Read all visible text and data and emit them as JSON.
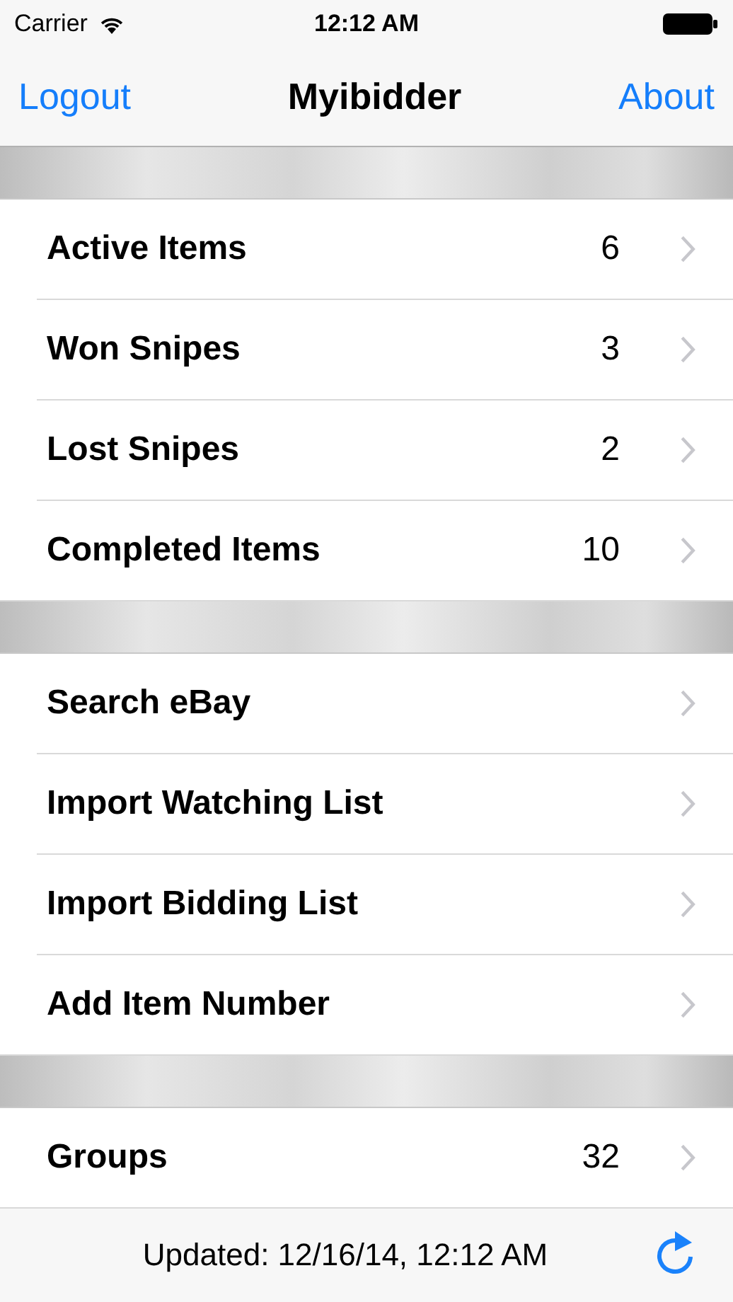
{
  "status_bar": {
    "carrier": "Carrier",
    "time": "12:12 AM"
  },
  "nav_bar": {
    "left_button": "Logout",
    "title": "Myibidder",
    "right_button": "About"
  },
  "sections": [
    {
      "rows": [
        {
          "label": "Active Items",
          "count": "6"
        },
        {
          "label": "Won Snipes",
          "count": "3"
        },
        {
          "label": "Lost Snipes",
          "count": "2"
        },
        {
          "label": "Completed Items",
          "count": "10"
        }
      ]
    },
    {
      "rows": [
        {
          "label": "Search eBay"
        },
        {
          "label": "Import Watching List"
        },
        {
          "label": "Import Bidding List"
        },
        {
          "label": "Add Item Number"
        }
      ]
    },
    {
      "rows": [
        {
          "label": "Groups",
          "count": "32"
        }
      ]
    }
  ],
  "toolbar": {
    "status": "Updated: 12/16/14, 12:12 AM"
  }
}
